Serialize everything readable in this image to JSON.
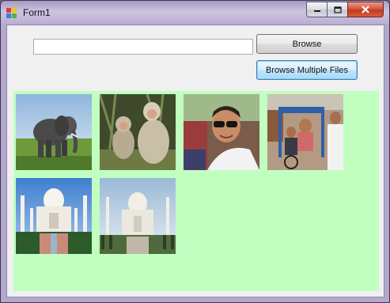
{
  "window": {
    "title": "Form1"
  },
  "form": {
    "path_value": "",
    "browse_label": "Browse",
    "browse_multiple_label": "Browse Multiple Files"
  },
  "colors": {
    "panel_bg": "#c0ffc0",
    "title_bar": "#b9add3",
    "close_button": "#c8432a"
  },
  "gallery": {
    "images": [
      {
        "subject": "elephant"
      },
      {
        "subject": "monkeys"
      },
      {
        "subject": "boy-with-sunglasses"
      },
      {
        "subject": "people-in-rickshaw"
      },
      {
        "subject": "taj-mahal"
      },
      {
        "subject": "taj-mahal"
      }
    ]
  }
}
